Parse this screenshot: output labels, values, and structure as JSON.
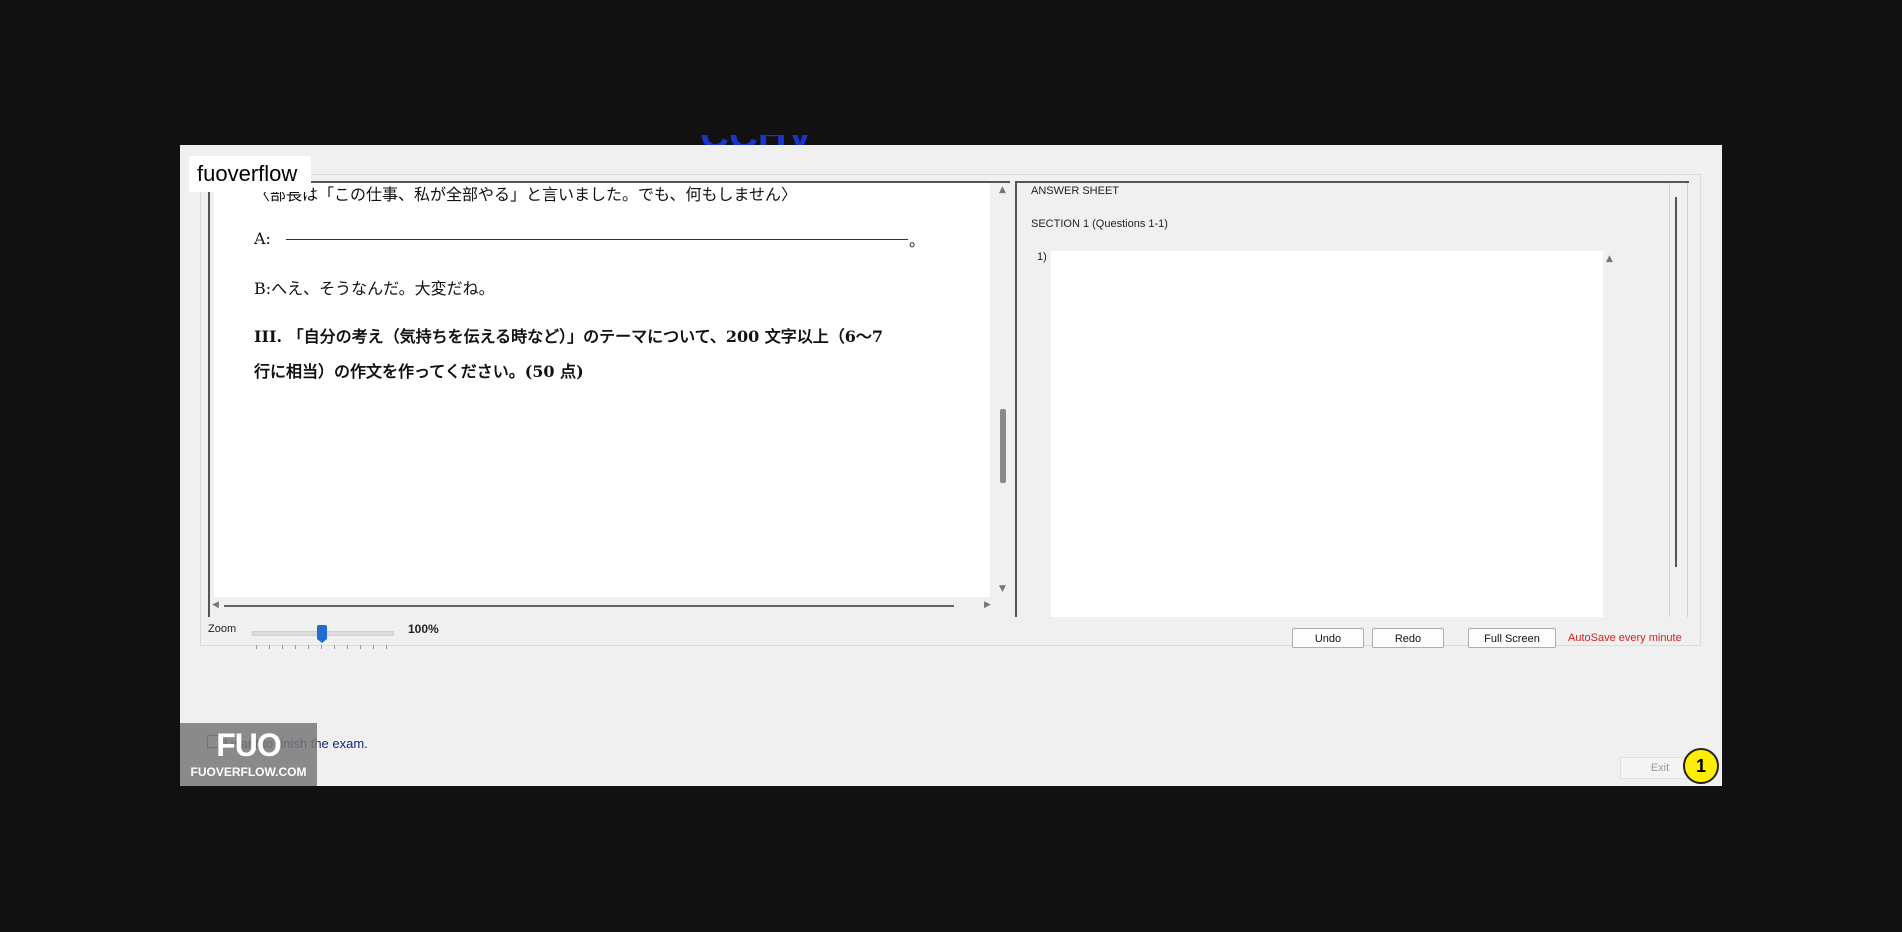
{
  "branding": {
    "watermark": "fuoverflow",
    "logo_big": "FUO",
    "logo_small": "FUOVERFLOW.COM",
    "top_fragment": "CCHV"
  },
  "question": {
    "line_partial": "〈部長は「この仕事、私が全部やる」と言いました。でも、何もしません〉",
    "answer_prefix": "A:",
    "answer_suffix": "。",
    "line_b": "B:へえ、そうなんだ。大変だね。",
    "section3_line1": "III. 「自分の考え（気持ちを伝える時など）」のテーマについて、200 文字以上（6〜7",
    "section3_line2": "行に相当）の作文を作ってください。(50 点)"
  },
  "zoom": {
    "label": "Zoom",
    "value": "100%",
    "level_percent": 100
  },
  "answer_sheet": {
    "title": "ANSWER SHEET",
    "section": "SECTION 1 (Questions 1-1)",
    "question_number": "1)",
    "answer_value": ""
  },
  "buttons": {
    "undo": "Undo",
    "redo": "Redo",
    "full_screen": "Full Screen",
    "autosave": "AutoSave every minute",
    "exit": "Exit"
  },
  "finish": {
    "label": "I want to finish the exam.",
    "checked": false
  },
  "badge": "1",
  "colors": {
    "autosave": "#d21f1f",
    "badge": "#ffee00",
    "slider": "#1e6fd0"
  }
}
